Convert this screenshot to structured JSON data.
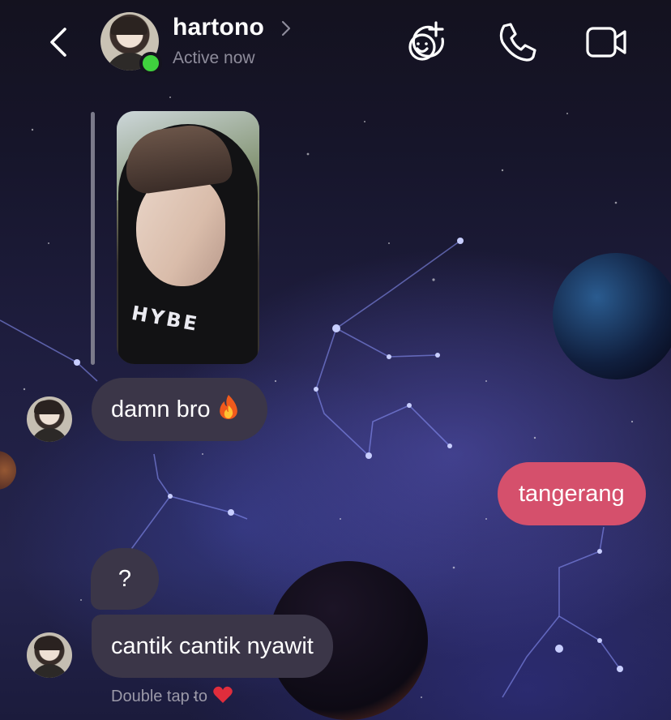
{
  "colors": {
    "accent_outgoing": "#d5506c",
    "incoming_bubble": "#3b3648",
    "online": "#3fd13e",
    "muted_text": "#8e8c9b"
  },
  "header": {
    "back_icon": "chevron-left-icon",
    "name": "hartono",
    "status": "Active now",
    "actions": [
      "add-effect-icon",
      "phone-icon",
      "video-camera-icon"
    ]
  },
  "thread": {
    "shared_photo": {
      "printed_text": "HYBE"
    },
    "messages": [
      {
        "direction": "incoming",
        "text": "damn bro",
        "emoji": "fire"
      },
      {
        "direction": "outgoing",
        "text": "tangerang"
      },
      {
        "direction": "incoming",
        "text": "?"
      },
      {
        "direction": "incoming",
        "text": "cantik cantik nyawit"
      }
    ],
    "hint": {
      "text": "Double tap to",
      "emoji": "heart"
    }
  }
}
